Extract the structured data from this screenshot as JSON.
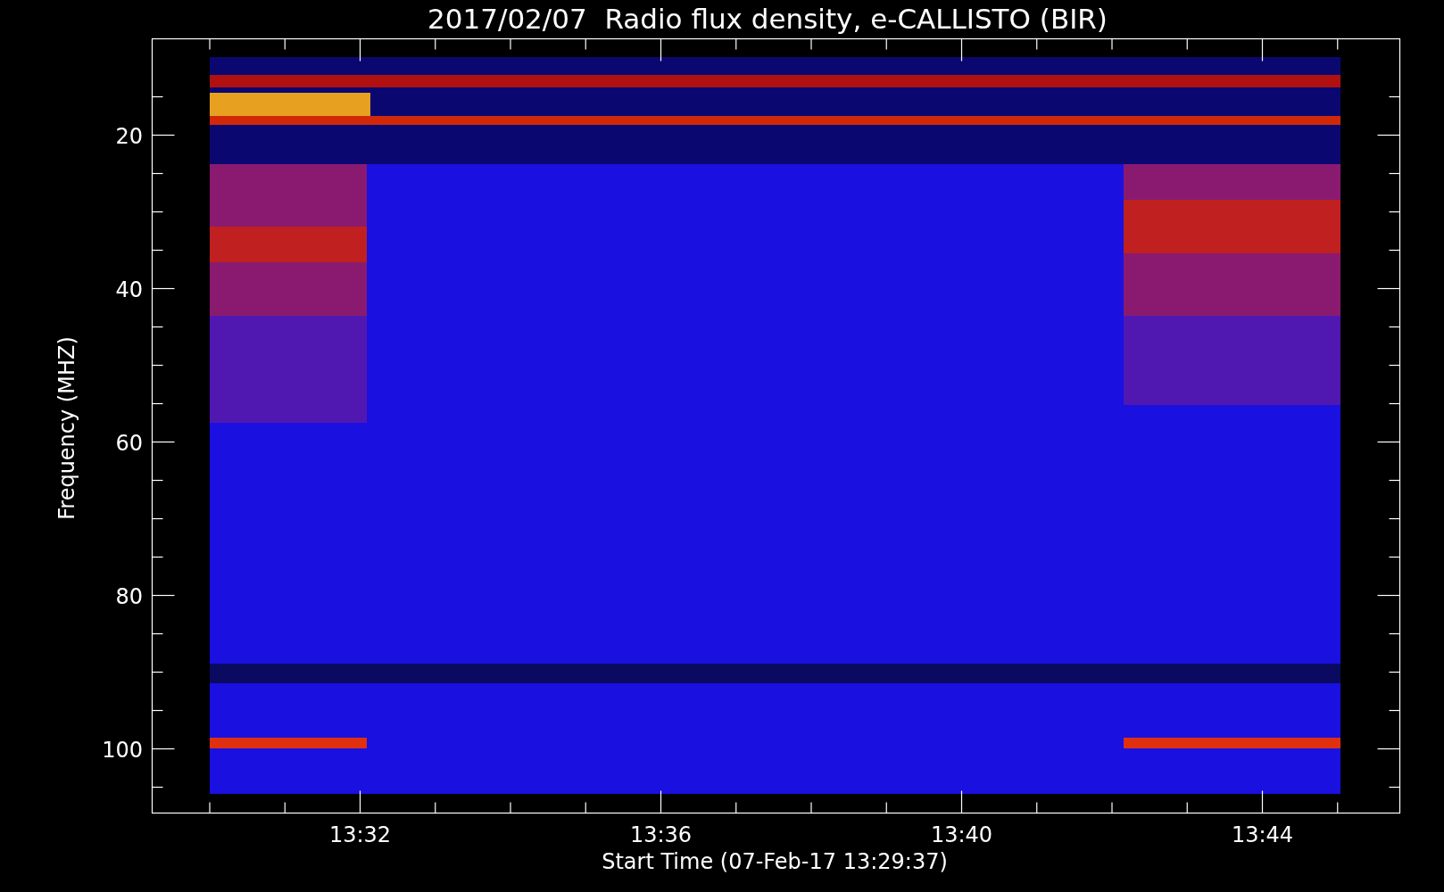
{
  "title": "2017/02/07  Radio flux density, e-CALLISTO (BIR)",
  "y_axis": {
    "label": "Frequency (MHZ)",
    "ticks": [
      "20",
      "40",
      "60",
      "80",
      "100"
    ]
  },
  "x_axis": {
    "label": "Start Time (07-Feb-17 13:29:37)",
    "ticks": [
      "13:32",
      "13:36",
      "13:40",
      "13:44"
    ]
  }
}
